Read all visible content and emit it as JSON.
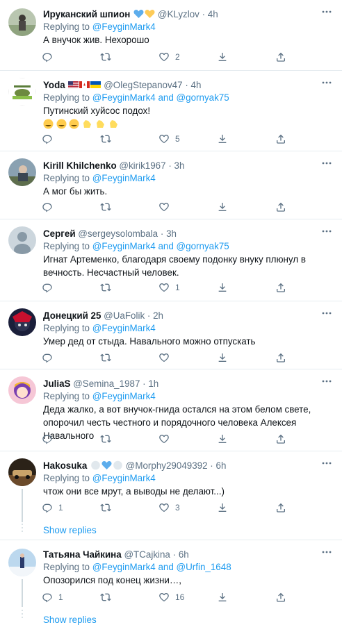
{
  "colors": {
    "link": "#1d9bf0",
    "muted": "#5b7083",
    "text": "#0f1419",
    "divider": "#e6ecf0"
  },
  "icons": [
    "more-icon",
    "reply-icon",
    "retweet-icon",
    "like-icon",
    "share-icon",
    "upload-icon",
    "heart-emoji",
    "flag-emoji",
    "rofl-emoji",
    "clap-emoji"
  ],
  "tweets": [
    {
      "name": "Ируканский шпион",
      "handle": "@KLyzlov",
      "time": "4h",
      "reply_prefix": "Replying to",
      "reply_targets": "@FeyginMark4",
      "reply_joiner": "",
      "reply_second": "",
      "text": "А внучок жив. Нехорошо",
      "reply_count": "",
      "retweet_count": "",
      "like_count": "2"
    },
    {
      "name": "Yoda",
      "handle": "@OlegStepanov47",
      "time": "4h",
      "reply_prefix": "Replying to",
      "reply_targets": "@FeyginMark4",
      "reply_joiner": "and",
      "reply_second": "@gornyak75",
      "text": "Путинский хуйсос подох!",
      "reply_count": "",
      "retweet_count": "",
      "like_count": "5"
    },
    {
      "name": "Kirill Khilchenko",
      "handle": "@kirik1967",
      "time": "3h",
      "reply_prefix": "Replying to",
      "reply_targets": "@FeyginMark4",
      "reply_joiner": "",
      "reply_second": "",
      "text": "А мог бы жить.",
      "reply_count": "",
      "retweet_count": "",
      "like_count": ""
    },
    {
      "name": "Сергей",
      "handle": "@sergeysolombala",
      "time": "3h",
      "reply_prefix": "Replying to",
      "reply_targets": "@FeyginMark4",
      "reply_joiner": "and",
      "reply_second": "@gornyak75",
      "text": "Игнат Артеменко, благодаря своему подонку внуку плюнул в вечность. Несчастный человек.",
      "reply_count": "",
      "retweet_count": "",
      "like_count": "1"
    },
    {
      "name": "Донецкий 25",
      "handle": "@UaFolik",
      "time": "2h",
      "reply_prefix": "Replying to",
      "reply_targets": "@FeyginMark4",
      "reply_joiner": "",
      "reply_second": "",
      "text": "Умер дед от стыда. Навального можно отпускать",
      "reply_count": "",
      "retweet_count": "",
      "like_count": ""
    },
    {
      "name": "JuliaS",
      "handle": "@Semina_1987",
      "time": "1h",
      "reply_prefix": "Replying to",
      "reply_targets": "@FeyginMark4",
      "reply_joiner": "",
      "reply_second": "",
      "text": "Деда жалко, а вот внучок-гнида остался на этом белом свете, опорочил честь честного и порядочного человека Алексея Навального",
      "reply_count": "",
      "retweet_count": "",
      "like_count": ""
    },
    {
      "name": "Hakosuka",
      "handle": "@Morphy29049392",
      "time": "6h",
      "reply_prefix": "Replying to",
      "reply_targets": "@FeyginMark4",
      "reply_joiner": "",
      "reply_second": "",
      "text": "чтож они все мрут, а выводы не делают...)",
      "reply_count": "1",
      "retweet_count": "",
      "like_count": "3",
      "show_replies": "Show replies"
    },
    {
      "name": "Татьяна Чайкина",
      "handle": "@TCajkina",
      "time": "6h",
      "reply_prefix": "Replying to",
      "reply_targets": "@FeyginMark4",
      "reply_joiner": "and",
      "reply_second": "@Urfin_1648",
      "text": "Опозорился под конец жизни…,",
      "reply_count": "1",
      "retweet_count": "",
      "like_count": "16",
      "show_replies": "Show replies"
    }
  ]
}
